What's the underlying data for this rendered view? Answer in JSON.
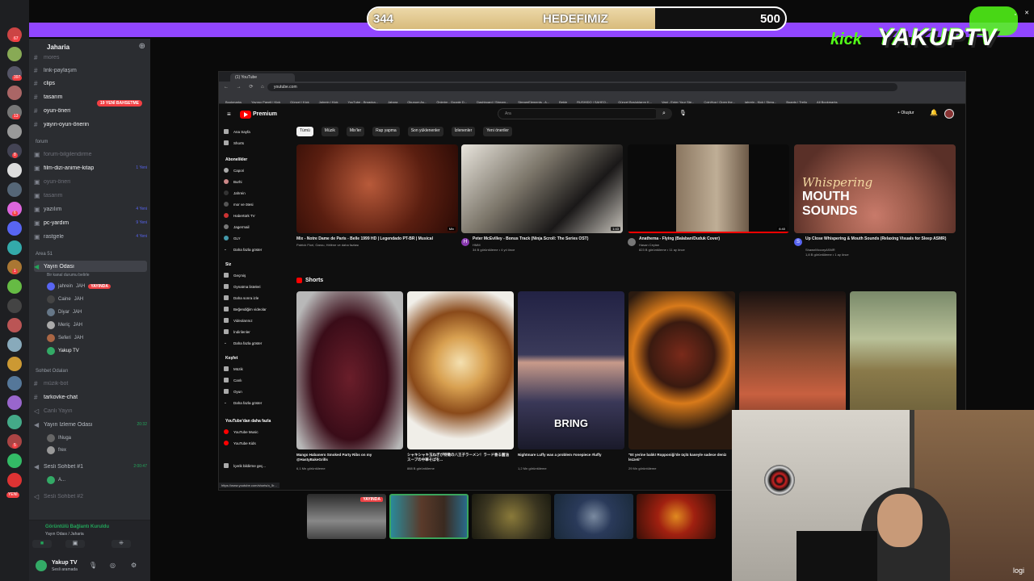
{
  "goal": {
    "current": "344",
    "label": "HEDEFIMIZ",
    "target": "500",
    "progress_fraction": 0.688
  },
  "ticker": "",
  "logo": {
    "kick": "kick",
    "brand": "YAKUPTV"
  },
  "discord": {
    "server_name": "Jaharia",
    "new_tag": "19 YENİ BAHSETME",
    "channels_top": [
      "mores",
      "link-paylaşım",
      "clips",
      "tasarım",
      "oyun-öneri",
      "yayın-oyun-önerin"
    ],
    "forum_category": "forum",
    "forum_channels": [
      {
        "name": "forum-bilgilendirme",
        "badge": ""
      },
      {
        "name": "film-dizi-anime-kitap",
        "badge": "1 Yeni"
      },
      {
        "name": "oyun-öneri",
        "badge": ""
      },
      {
        "name": "tasarım",
        "badge": ""
      },
      {
        "name": "yazılım",
        "badge": "4 Yeni"
      },
      {
        "name": "pc-yardım",
        "badge": "9 Yeni"
      },
      {
        "name": "rastgele",
        "badge": "4 Yeni"
      }
    ],
    "area_category": "Area 51",
    "voice_channel": {
      "name": "Yayın Odası",
      "desc": "Bir kanal durumu belirle"
    },
    "voice_users": [
      {
        "name": "jahrein",
        "role": "JAH",
        "live": "YAYINDA"
      },
      {
        "name": "Caine",
        "role": "JAH",
        "live": ""
      },
      {
        "name": "Diyar",
        "role": "JAH",
        "live": ""
      },
      {
        "name": "Meriç",
        "role": "JAH",
        "live": ""
      },
      {
        "name": "Seferi",
        "role": "JAH",
        "live": ""
      },
      {
        "name": "Yakup TV",
        "role": "",
        "live": ""
      }
    ],
    "chat_category": "Sohbet Odaları",
    "chat_channels": [
      {
        "name": "müzik-bot",
        "extra": ""
      },
      {
        "name": "tarkovke-chat",
        "extra": ""
      },
      {
        "name": "Canlı Yayın",
        "extra": ""
      },
      {
        "name": "Yayın İzleme Odası",
        "extra": "20:32"
      },
      {
        "name": "INuga",
        "extra": ""
      },
      {
        "name": "frex",
        "extra": ""
      },
      {
        "name": "Sesli Sohbet #1",
        "extra": "2:00:47"
      },
      {
        "name": "A...",
        "extra": ""
      },
      {
        "name": "Sesli Sohbet #2",
        "extra": ""
      }
    ],
    "connection": {
      "status": "Görüntülü Bağlantı Kuruldu",
      "location": "Yayın Odası / Jaharia"
    },
    "user": {
      "name": "Yakup TV",
      "status": "Sesli aramada"
    },
    "rail_badges": [
      "67",
      "397",
      "13",
      "8",
      "6",
      "1",
      "5",
      "YENİ"
    ]
  },
  "browser": {
    "tab_title": "(1) YouTube",
    "url": "youtube.com",
    "bookmarks": [
      "Bookmarks",
      "Yayıncı Paneli | Kick",
      "Güncel | Kick",
      "Jahrein | Kick",
      "YouTube - Broadca...",
      "Jahara",
      "Okunum Aş...",
      "Önlerim - Google D...",
      "Dashboard / Stream...",
      "StreamElements - A...",
      "Bekle",
      "RUSHIDO | SAHEO...",
      "Güncel Boşluklarım K...",
      "Vast - Enter Your Ste...",
      "CoinHug | Open the...",
      "jahrein - Kick | Strea...",
      "Boards | Trello",
      "All Bookmarks"
    ],
    "status_url": "https://www.youtube.com/shorts/o_5r..."
  },
  "youtube": {
    "brand": "Premium",
    "search_placeholder": "Ara",
    "create_label": "Oluştur",
    "chips": [
      "Tümü",
      "Müzik",
      "Mix'ler",
      "Rap yapma",
      "Son yüklenenler",
      "İzlenenler",
      "Yeni öneriler"
    ],
    "sidebar": {
      "main": [
        "Ana Sayfa",
        "Shorts"
      ],
      "subs_header": "Abonelikler",
      "subs": [
        "Capori",
        "Burhi",
        "Jahrein",
        "mor ve ötesi",
        "Habertürk TV",
        "Jagermail",
        "GLY",
        "Daha fazla göster"
      ],
      "you_header": "Siz",
      "you": [
        "Geçmiş",
        "Oynatma listeleri",
        "Daha sonra izle",
        "Beğendiğim videolar",
        "Videolarınız",
        "İndirilenler",
        "Daha fazla göster"
      ],
      "explore_header": "Keşfet",
      "explore": [
        "Müzik",
        "Canlı",
        "Oyun",
        "Daha fazla göster"
      ],
      "more_header": "YouTube'dan daha fazla",
      "more": [
        "YouTube Music",
        "YouTube Kids"
      ],
      "footer": "İçerik bildirme geç..."
    },
    "videos": [
      {
        "title": "Mix - Notre Dame de Paris - Belle 1999 HD | Legendado PT-BR | Musical",
        "meta": "Patrick Fiori, Garou, Hélène ve daha fazlası",
        "duration": "Mix",
        "avatar": "",
        "views": ""
      },
      {
        "title": "Peter McEvilley - Bonus Track (Ninja Scroll: The Series OST)",
        "meta": "HMM",
        "duration": "1:43",
        "avatar": "H",
        "views": "34 B görüntüleme • 4 yıl önce"
      },
      {
        "title": "Anathema - Flying (Balaban/Duduk Cover)",
        "meta": "Hasan Ceylan",
        "duration": "6:40",
        "avatar": "",
        "views": "823 B görüntüleme • 11 ay önce"
      },
      {
        "title": "Up Close Whispering & Mouth Sounds (Relaxing Visuals for Sleep ASMR)",
        "meta": "ShawnMccoryASMR",
        "duration": "",
        "avatar": "S",
        "views": "1,8 B görüntüleme • 1 ay önce",
        "thumb_text1": "Whispering",
        "thumb_text2": "MOUTH",
        "thumb_text3": "SOUNDS"
      }
    ],
    "shorts_header": "Shorts",
    "shorts": [
      {
        "title": "Mango Habanero Smoked Party Ribs on my @HastyBakeGrills",
        "views": "6,1 Mn görüntüleme"
      },
      {
        "title": "シャキシャキ玉ねぎが特徴の八王子ラーメン！ラード香る醤油スープの中華そばを...",
        "views": "888 B görüntüleme"
      },
      {
        "title": "Nightmare Luffy was a problem #onepiece #luffy",
        "views": "1,2 Mn görüntüleme",
        "overlay": "BRING"
      },
      {
        "title": "\"Et yerine balık! Ropponiği'de üçlü kaseyle sadece deniz lezzeti\"",
        "views": "29 Mn görüntüleme"
      },
      {
        "title": "",
        "views": ""
      },
      {
        "title": "",
        "views": ""
      }
    ]
  },
  "cams": [
    {
      "live": "YAYINDA"
    },
    {
      "live": ""
    },
    {
      "live": ""
    },
    {
      "live": ""
    },
    {
      "live": ""
    }
  ],
  "watermark": "logi"
}
